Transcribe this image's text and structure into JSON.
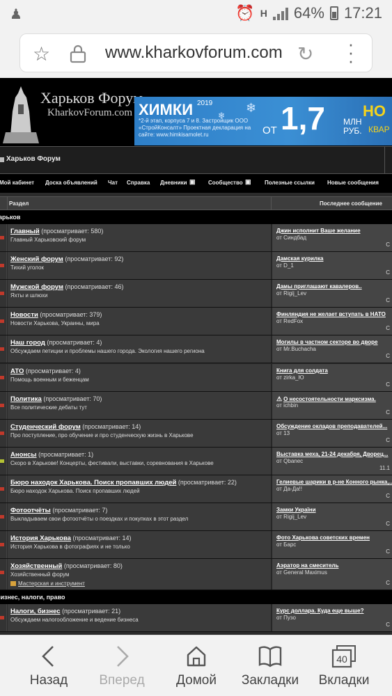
{
  "status_bar": {
    "battery": "64%",
    "time": "17:21",
    "network": "H"
  },
  "browser": {
    "url": "www.kharkovforum.com"
  },
  "banner": {
    "logo_title": "Харьков Форум",
    "logo_sub": "KharkovForum.com",
    "ad": {
      "headline": "ХИМКИ",
      "year": "2019",
      "details": "*2-й этап, корпуса 7 и 8. Застройщик ООО «СтройКонсалт» Проектная декларация на сайте: www.himkisamolet.ru",
      "from": "ОТ",
      "price": "1,7",
      "price_unit_1": "МЛН",
      "price_unit_2": "РУБ.",
      "tag_1": "НО",
      "tag_2": "КВАР"
    }
  },
  "forum": {
    "title": "Харьков Форум",
    "nav": [
      "Мой кабинет",
      "Доска объявлений",
      "Чат",
      "Справка",
      "Дневники",
      "Сообщество",
      "Полезные ссылки",
      "Новые сообщения"
    ],
    "col_section": "Раздел",
    "col_last": "Последнее сообщение",
    "category_1": "Харьков",
    "category_2": "Бизнес, налоги, право",
    "rows": [
      {
        "name": "Главный",
        "viewers": "(просматривает: 580)",
        "desc": "Главный Харьковский форум",
        "last_title": "Джин исполнит Ваше желание",
        "last_by": "от Синдбад",
        "ts": "С"
      },
      {
        "name": "Женский форум",
        "viewers": "(просматривает: 92)",
        "desc": "Тихий уголок",
        "last_title": "Дамская курилка",
        "last_by": "от D_1",
        "ts": "С"
      },
      {
        "name": "Мужской форум",
        "viewers": "(просматривает: 46)",
        "desc": "Яхты и шлюхи",
        "last_title": "Дамы приглашают кавалеров..",
        "last_by": "от Rigij_Lev",
        "ts": "С"
      },
      {
        "name": "Новости",
        "viewers": "(просматривает: 379)",
        "desc": "Новости Харькова, Украины, мира",
        "last_title": "Финляндия не желает вступать в НАТО",
        "last_by": "от RedFox",
        "ts": "С"
      },
      {
        "name": "Наш город",
        "viewers": "(просматривает: 4)",
        "desc": "Обсуждаем петиции и проблемы нашего города. Экология нашего региона",
        "last_title": "Могилы в частном секторе во дворе",
        "last_by": "от Mr.Buchacha",
        "ts": "С"
      },
      {
        "name": "АТО",
        "viewers": "(просматривает: 4)",
        "desc": "Помощь военным и беженцам",
        "last_title": "Книга для солдата",
        "last_by": "от zirka_Ю",
        "ts": "С"
      },
      {
        "name": "Политика",
        "viewers": "(просматривает: 70)",
        "desc": "Все политические дебаты тут",
        "last_title": "О несостоятельности марксизма.",
        "last_by": "от ichbin",
        "ts": "С",
        "warn": true
      },
      {
        "name": "Студенческий форум",
        "viewers": "(просматривает: 14)",
        "desc": "Про поступление, про обучение и про студенческую жизнь в Харькове",
        "last_title": "Обсуждение окладов преподавателей...",
        "last_by": "от 13",
        "ts": "С"
      },
      {
        "name": "Анонсы",
        "viewers": "(просматривает: 1)",
        "desc": "Скоро в Харькове! Концерты, фестивали, выставки, соревнования в Харькове",
        "last_title": "Выставка меха, 21-24 декабря, Дворец...",
        "last_by": "от Qbanec",
        "ts": "11.1",
        "green": true
      },
      {
        "name": "Бюро находок Харькова. Поиск пропавших людей",
        "viewers": "(просматривает: 22)",
        "desc": "Бюро находок Харькова. Поиск пропавших людей",
        "last_title": "Гелиевые шарики в р-не Конного рынка,...",
        "last_by": "от Да-Да!!",
        "ts": "С"
      },
      {
        "name": "Фотоотчёты",
        "viewers": "(просматривает: 7)",
        "desc": "Выкладываем свои фотоотчёты о поездках и покупках в этот раздел",
        "last_title": "Замки України",
        "last_by": "от Rigij_Lev",
        "ts": "С"
      },
      {
        "name": "История Харькова",
        "viewers": "(просматривает: 14)",
        "desc": "История Харькова в фотографиях и не только",
        "last_title": "Фото Харькова советских времен",
        "last_by": "от Барс",
        "ts": "С"
      },
      {
        "name": "Хозяйственный",
        "viewers": "(просматривает: 80)",
        "desc": "Хозяйственный форум",
        "sub": "Мастерская и инструмент",
        "last_title": "Аэратор на смеситель",
        "last_by": "от General Maximus",
        "ts": "С"
      },
      {
        "name": "Налоги, бизнес",
        "viewers": "(просматривает: 21)",
        "desc": "Обсуждаем налогообложение и ведение бизнеса",
        "last_title": "Курс доллара. Куда еще выше?",
        "last_by": "от Пузо",
        "ts": "С"
      }
    ]
  },
  "toolbar": {
    "back": "Назад",
    "forward": "Вперед",
    "home": "Домой",
    "bookmarks": "Закладки",
    "tabs": "Вкладки",
    "tab_count": "40"
  }
}
